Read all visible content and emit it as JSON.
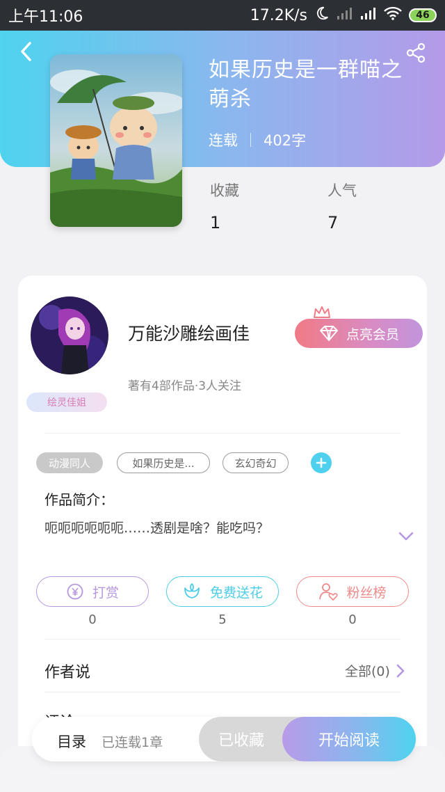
{
  "status_bar": {
    "time": "上午11:06",
    "network_speed": "17.2K/s",
    "battery_level": "46"
  },
  "book": {
    "title": "如果历史是一群喵之萌杀",
    "status": "连载",
    "word_count": "402字",
    "stats": [
      {
        "label": "收藏",
        "value": "1"
      },
      {
        "label": "人气",
        "value": "7"
      }
    ]
  },
  "author": {
    "name": "万能沙雕绘画佳",
    "info": "著有4部作品·3人关注",
    "badge": "绘灵佳姐",
    "member_button": "点亮会员"
  },
  "tags": [
    {
      "label": "动漫同人",
      "style": "filled"
    },
    {
      "label": "如果历史是...",
      "style": "outline"
    },
    {
      "label": "玄幻奇幻",
      "style": "outline"
    }
  ],
  "intro": {
    "title": "作品简介：",
    "text": "呃呃呃呃呃呃……透剧是啥？能吃吗？"
  },
  "actions": [
    {
      "label": "打赏",
      "count": "0",
      "color": "#b597e0"
    },
    {
      "label": "免费送花",
      "count": "5",
      "color": "#4ccde6"
    },
    {
      "label": "粉丝榜",
      "count": "0",
      "color": "#ee8a8a"
    }
  ],
  "author_says": {
    "title": "作者说",
    "link": "全部(0)"
  },
  "next_section_title": "评论",
  "bottom": {
    "toc": "目录",
    "toc_info": "已连载1章",
    "collected": "已收藏",
    "read": "开始阅读"
  },
  "colors": {
    "header_gradient_start": "#4fd3ef",
    "header_gradient_end": "#b49ae8",
    "accent_cyan": "#4fd0ef",
    "accent_purple": "#b597e0",
    "accent_pink": "#ee8a8a"
  },
  "icons": {
    "back": "chevron-left-icon",
    "share": "share-icon",
    "wifi": "wifi-icon",
    "signal": "signal-icon",
    "moon": "moon-icon",
    "diamond": "diamond-icon",
    "crown": "crown-icon",
    "plus": "plus-icon",
    "yen": "yen-icon",
    "flower": "flower-icon",
    "fans": "user-heart-icon",
    "expand": "chevron-down-icon",
    "arrow": "chevron-right-icon"
  }
}
